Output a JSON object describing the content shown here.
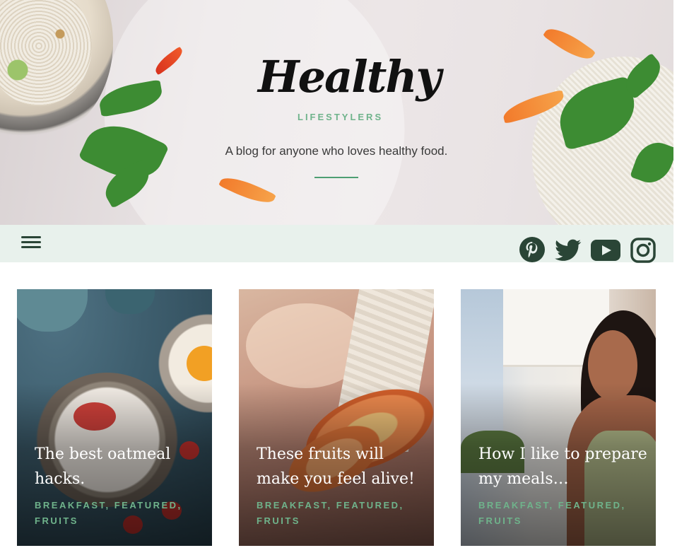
{
  "header": {
    "logo_title": "Healthy",
    "logo_subtitle": "LIFESTYLERS",
    "tagline": "A blog for anyone who loves healthy food."
  },
  "nav": {
    "menu_icon": "hamburger-menu-icon",
    "social": [
      {
        "name": "pinterest-icon"
      },
      {
        "name": "twitter-icon"
      },
      {
        "name": "youtube-icon"
      },
      {
        "name": "instagram-icon"
      }
    ]
  },
  "posts": [
    {
      "title": "The best oatmeal hacks.",
      "categories": "BREAKFAST, FEATURED, FRUITS"
    },
    {
      "title": "These fruits will make you feel alive!",
      "categories": "BREAKFAST, FEATURED, FRUITS"
    },
    {
      "title": "How I like to prepare my meals…",
      "categories": "BREAKFAST, FEATURED, FRUITS"
    }
  ],
  "colors": {
    "accent_green": "#6fb38b",
    "nav_bg": "#e8f1ec",
    "icon_dark": "#2a4536"
  }
}
